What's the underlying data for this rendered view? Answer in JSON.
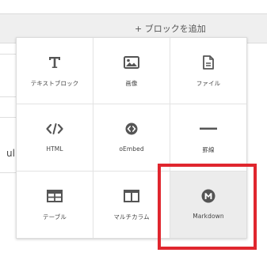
{
  "header": {
    "add_block": "+ ブロックを追加"
  },
  "background": {
    "list_text": "ul"
  },
  "menu": {
    "items": [
      {
        "label": "テキストブロック",
        "icon": "text-t-icon"
      },
      {
        "label": "画像",
        "icon": "image-icon"
      },
      {
        "label": "ファイル",
        "icon": "file-icon"
      },
      {
        "label": "HTML",
        "icon": "code-icon"
      },
      {
        "label": "oEmbed",
        "icon": "embed-icon"
      },
      {
        "label": "罫線",
        "icon": "horizontal-rule-icon"
      },
      {
        "label": "テーブル",
        "icon": "table-icon"
      },
      {
        "label": "マルチカラム",
        "icon": "columns-icon"
      },
      {
        "label": "Markdown",
        "icon": "markdown-icon"
      }
    ],
    "selected": "Markdown"
  },
  "colors": {
    "highlight": "#e0262e",
    "icon": "#555555",
    "selected_bg": "#ececec"
  }
}
